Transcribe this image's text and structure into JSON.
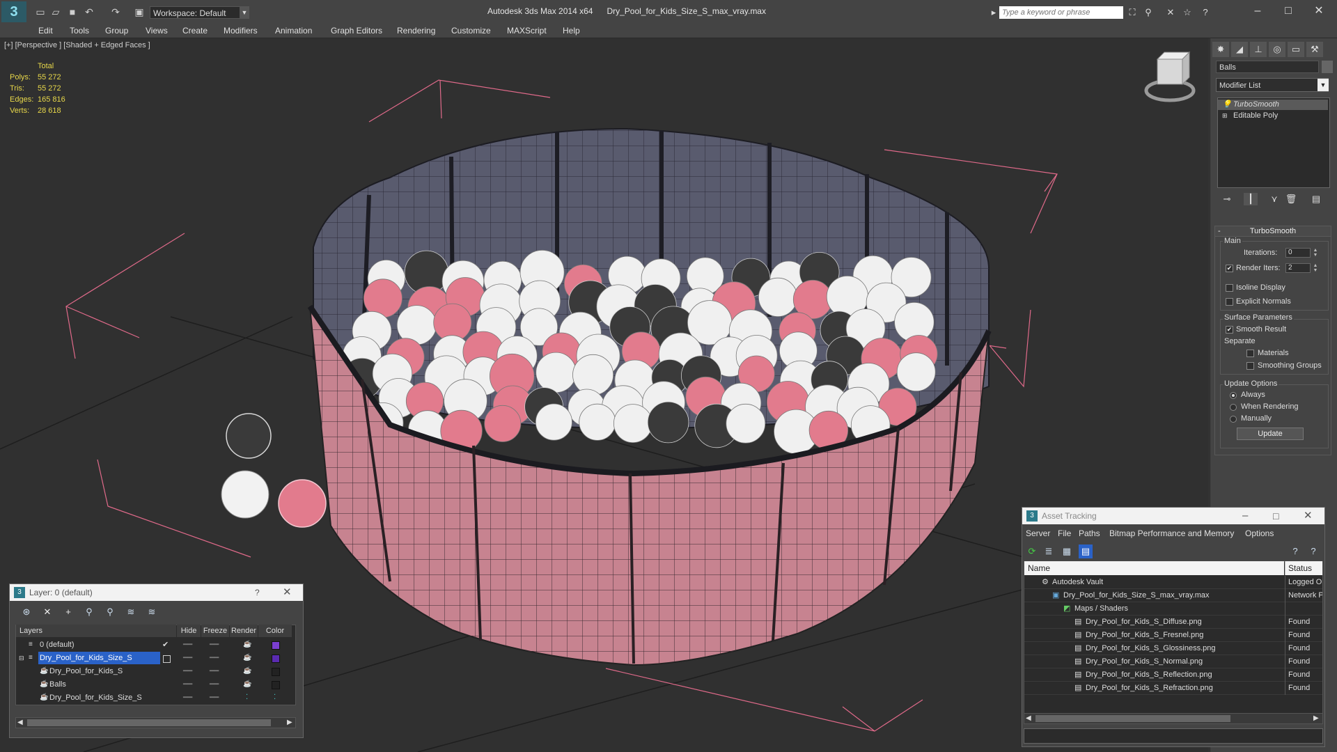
{
  "app": {
    "title": "Autodesk 3ds Max  2014 x64",
    "filename": "Dry_Pool_for_Kids_Size_S_max_vray.max",
    "workspace": "Workspace: Default",
    "search_placeholder": "Type a keyword or phrase"
  },
  "menu": [
    "Edit",
    "Tools",
    "Group",
    "Views",
    "Create",
    "Modifiers",
    "Animation",
    "Graph Editors",
    "Rendering",
    "Customize",
    "MAXScript",
    "Help"
  ],
  "viewport": {
    "label": "[+] [Perspective ] [Shaded + Edged Faces ]",
    "stats": {
      "header": "Total",
      "rows": [
        {
          "label": "Polys:",
          "value": "55 272"
        },
        {
          "label": "Tris:",
          "value": "55 272"
        },
        {
          "label": "Edges:",
          "value": "165 816"
        },
        {
          "label": "Verts:",
          "value": "28 618"
        }
      ]
    }
  },
  "command_panel": {
    "object_name": "Balls",
    "modifier_list": "Modifier List",
    "stack": [
      "TurboSmooth",
      "Editable Poly"
    ],
    "turbosmooth": {
      "title": "TurboSmooth",
      "main": "Main",
      "iterations_label": "Iterations:",
      "iterations": "0",
      "render_iters_label": "Render Iters:",
      "render_iters": "2",
      "isoline": "Isoline Display",
      "explicit": "Explicit Normals",
      "surface": "Surface Parameters",
      "smooth_result": "Smooth Result",
      "separate": "Separate",
      "materials": "Materials",
      "smoothing_groups": "Smoothing Groups",
      "update_options": "Update Options",
      "always": "Always",
      "when_rendering": "When Rendering",
      "manually": "Manually",
      "update": "Update"
    }
  },
  "layer_window": {
    "title": "Layer: 0 (default)",
    "help": "?",
    "columns": [
      "Layers",
      "Hide",
      "Freeze",
      "Render",
      "Color"
    ],
    "rows": [
      {
        "name": "0 (default)",
        "color": "#7b3fd0"
      },
      {
        "name": "Dry_Pool_for_Kids_Size_S",
        "color": "#5a2bb0"
      },
      {
        "name": "Dry_Pool_for_Kids_S",
        "color": "#222222"
      },
      {
        "name": "Balls",
        "color": "#222222"
      },
      {
        "name": "Dry_Pool_for_Kids_Size_S",
        "color": ""
      }
    ]
  },
  "asset_window": {
    "title": "Asset Tracking",
    "menu": [
      "Server",
      "File",
      "Paths",
      "Bitmap Performance and Memory",
      "Options"
    ],
    "columns": [
      "Name",
      "Status"
    ],
    "rows": [
      {
        "name": "Autodesk Vault",
        "status": "Logged O"
      },
      {
        "name": "Dry_Pool_for_Kids_Size_S_max_vray.max",
        "status": "Network P"
      },
      {
        "name": "Maps / Shaders",
        "status": ""
      },
      {
        "name": "Dry_Pool_for_Kids_S_Diffuse.png",
        "status": "Found"
      },
      {
        "name": "Dry_Pool_for_Kids_S_Fresnel.png",
        "status": "Found"
      },
      {
        "name": "Dry_Pool_for_Kids_S_Glossiness.png",
        "status": "Found"
      },
      {
        "name": "Dry_Pool_for_Kids_S_Normal.png",
        "status": "Found"
      },
      {
        "name": "Dry_Pool_for_Kids_S_Reflection.png",
        "status": "Found"
      },
      {
        "name": "Dry_Pool_for_Kids_S_Refraction.png",
        "status": "Found"
      }
    ]
  },
  "colors": {
    "selection": "#2a62c8",
    "stats": "#e8d84a",
    "pool_wall": "#c87d8a",
    "grid_line": "#e06a8a"
  }
}
